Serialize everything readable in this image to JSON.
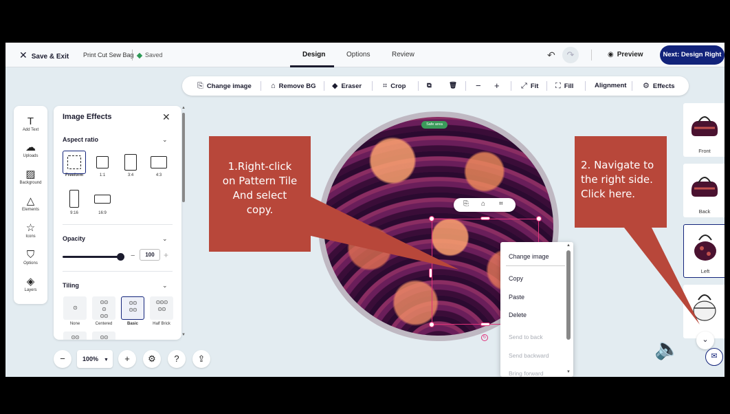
{
  "topbar": {
    "save_exit": "Save & Exit",
    "project_name": "Print Cut Sew Bag",
    "status": "Saved",
    "tabs": [
      "Design",
      "Options",
      "Review"
    ],
    "preview": "Preview",
    "next": "Next: Design Right"
  },
  "toolbar": {
    "change_image": "Change image",
    "remove_bg": "Remove BG",
    "eraser": "Eraser",
    "crop": "Crop",
    "fit": "Fit",
    "fill": "Fill",
    "alignment": "Alignment",
    "effects": "Effects"
  },
  "rail": [
    "Add Text",
    "Uploads",
    "Background",
    "Elements",
    "Icons",
    "Options",
    "Layers"
  ],
  "panel": {
    "title": "Image Effects",
    "aspect_ratio": "Aspect ratio",
    "ratios": [
      "Freeform",
      "1:1",
      "3:4",
      "4:3",
      "9:16",
      "16:9"
    ],
    "opacity": "Opacity",
    "opacity_value": "100",
    "tiling": "Tiling",
    "tiling_options": [
      "None",
      "Centered",
      "Basic",
      "Half Brick"
    ]
  },
  "bottom": {
    "zoom": "100%"
  },
  "canvas": {
    "safe_area": "Safe area",
    "context_menu": [
      "Change image",
      "Copy",
      "Paste",
      "Delete",
      "Send to back",
      "Send backward",
      "Bring forward"
    ]
  },
  "views": [
    "Front",
    "Back",
    "Left",
    ""
  ],
  "callouts": {
    "one": [
      "1.Right-click",
      "on Pattern Tile",
      "And select",
      "copy."
    ],
    "two": [
      "2. Navigate to",
      "the right side.",
      "Click here."
    ]
  },
  "colors": {
    "accent": "#12237a",
    "callout": "#b8473a",
    "selection": "#e0307a"
  }
}
